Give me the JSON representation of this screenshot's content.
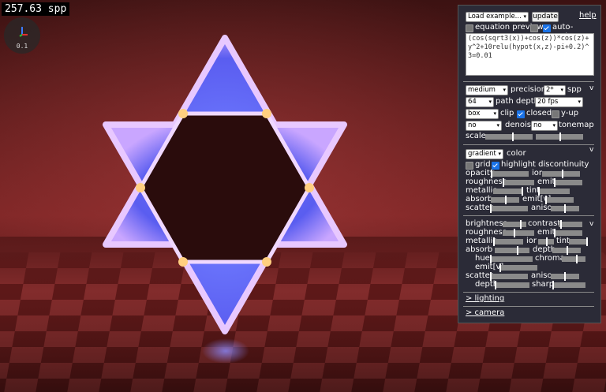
{
  "spp_readout": "257.63 spp",
  "axes_scale": "0.1",
  "top": {
    "load_example": "Load example...",
    "update": "update",
    "help": "help",
    "equation_preview": "equation preview",
    "auto_update": "auto-update",
    "equation": "(cos(sqrt3(x))+cos(z))*cos(z)+y^2+10relu(hypot(x,z)-pi+0.2)^3=0.01"
  },
  "render": {
    "precision_value": "medium",
    "precision_label": "precision",
    "spp_value": "2*",
    "spp_label": "spp",
    "path_depth_value": "64",
    "path_depth_label": "path depth",
    "fps_value": "20 fps",
    "clip_value": "box",
    "clip_label": "clip",
    "closed_label": "closed",
    "yup_label": "y-up",
    "denoise_value": "no",
    "denoise_label": "denoise",
    "tonemap_value": "no",
    "tonemap_label": "tonemap",
    "scale_label": "scale"
  },
  "material": {
    "color_mode": "gradient",
    "color_label": "color",
    "grid_label": "grid",
    "highlight_label": "highlight discontinuity",
    "opacity": "opacity",
    "ior": "ior",
    "roughness": "roughness",
    "emit": "emit",
    "metallic": "metallic",
    "tint": "tint",
    "absorb": "absorb",
    "emitv": "emit[v]",
    "scatter": "scatter",
    "aniso": "aniso"
  },
  "floor": {
    "brightness": "brightness",
    "contrast": "contrast",
    "roughness": "roughness",
    "emit": "emit",
    "metallic": "metallic",
    "ior": "ior",
    "tint": "tint",
    "absorb": "absorb",
    "depth": "depth",
    "hue": "hue",
    "chroma": "chroma",
    "emitv": "emit[v]",
    "scatter": "scatter",
    "aniso": "aniso",
    "depth2": "depth",
    "sharp": "sharp"
  },
  "links": {
    "lighting": "> lighting",
    "camera": "> camera"
  },
  "collapse_mark": "v"
}
